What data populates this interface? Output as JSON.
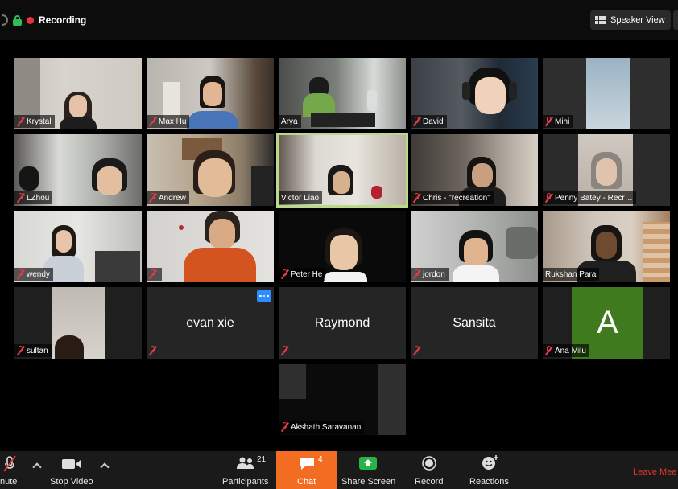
{
  "meeting": {
    "recording_label": "Recording",
    "speaker_view_label": "Speaker View"
  },
  "participants": [
    {
      "name": "Krystal",
      "muted": true
    },
    {
      "name": "Max Hu",
      "muted": true
    },
    {
      "name": "Arya",
      "muted": false
    },
    {
      "name": "David",
      "muted": true
    },
    {
      "name": "Mihi",
      "muted": true
    },
    {
      "name": "LZhou",
      "muted": true
    },
    {
      "name": "Andrew",
      "muted": true
    },
    {
      "name": "Victor Liao",
      "muted": false,
      "active_speaker": true
    },
    {
      "name": "Chris - \"recreation\"",
      "muted": true
    },
    {
      "name": "Penny Batey - Recr…",
      "muted": true
    },
    {
      "name": "wendy",
      "muted": true
    },
    {
      "name": "",
      "muted": true
    },
    {
      "name": "Peter He",
      "muted": true
    },
    {
      "name": "jordon",
      "muted": true
    },
    {
      "name": "Rukshan Para",
      "muted": false
    },
    {
      "name": "sultan",
      "muted": true
    },
    {
      "name": "evan xie",
      "muted": true,
      "video_off": true
    },
    {
      "name": "Raymond",
      "muted": true,
      "video_off": true
    },
    {
      "name": "Sansita",
      "muted": true,
      "video_off": true
    },
    {
      "name": "Ana Milu",
      "muted": true,
      "avatar_letter": "A"
    },
    {
      "name": "Akshath Saravanan",
      "muted": true
    }
  ],
  "toolbar": {
    "mute_label": "nute",
    "stop_video_label": "Stop Video",
    "participants_label": "Participants",
    "participants_count": "21",
    "chat_label": "Chat",
    "chat_badge": "4",
    "share_screen_label": "Share Screen",
    "record_label": "Record",
    "reactions_label": "Reactions",
    "leave_label": "Leave Mee"
  },
  "colors": {
    "chat_highlight": "#f26d21",
    "recording_dot": "#e8313f",
    "leave": "#e3382f",
    "active_speaker_border": "#b9d98b",
    "avatar_bg": "#3f7a1e",
    "share_green": "#26b34a"
  }
}
